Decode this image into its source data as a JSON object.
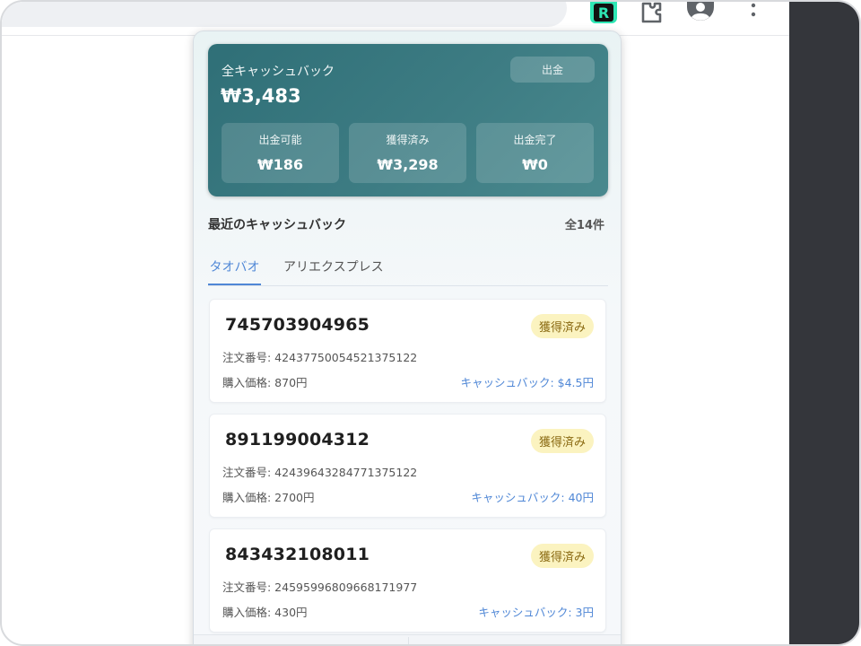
{
  "browser": {
    "extension_letter": "R",
    "icons": [
      "extension-r-icon",
      "puzzle-icon",
      "account-icon",
      "kebab-menu-icon"
    ]
  },
  "summary": {
    "label": "全キャッシュバック",
    "amount": "₩3,483",
    "withdraw_label": "出金",
    "stats": [
      {
        "label": "出金可能",
        "value": "₩186"
      },
      {
        "label": "獲得済み",
        "value": "₩3,298"
      },
      {
        "label": "出金完了",
        "value": "₩0"
      }
    ]
  },
  "recent": {
    "title": "最近のキャッシュバック",
    "count": "全14件"
  },
  "tabs": [
    {
      "label": "タオバオ",
      "active": true
    },
    {
      "label": "アリエクスプレス",
      "active": false
    }
  ],
  "cards": [
    {
      "product_id": "745703904965",
      "status": "獲得済み",
      "order": "注文番号: 42437750054521375122",
      "price": "購入価格: 870円",
      "cashback": "キャッシュバック: $4.5円"
    },
    {
      "product_id": "891199004312",
      "status": "獲得済み",
      "order": "注文番号: 42439643284771375122",
      "price": "購入価格: 2700円",
      "cashback": "キャッシュバック: 40円"
    },
    {
      "product_id": "843432108011",
      "status": "獲得済み",
      "order": "注文番号: 24595996809668171977",
      "price": "購入価格: 430円",
      "cashback": "キャッシュバック: 3円"
    }
  ],
  "colors": {
    "summary_bg": "#3d7c83",
    "accent": "#4f87d6",
    "badge_bg": "#fbf3c0",
    "extension_green": "#2ee6b4"
  }
}
